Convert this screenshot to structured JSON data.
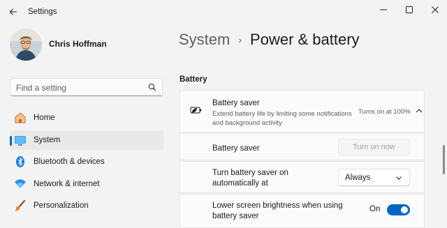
{
  "app": {
    "title": "Settings"
  },
  "user": {
    "name": "Chris Hoffman"
  },
  "search": {
    "placeholder": "Find a setting"
  },
  "nav": {
    "items": [
      {
        "label": "Home",
        "icon": "home-icon"
      },
      {
        "label": "System",
        "icon": "system-icon",
        "active": true
      },
      {
        "label": "Bluetooth & devices",
        "icon": "bluetooth-icon"
      },
      {
        "label": "Network & internet",
        "icon": "network-icon"
      },
      {
        "label": "Personalization",
        "icon": "brush-icon"
      }
    ]
  },
  "breadcrumb": {
    "parent": "System",
    "separator": "›",
    "current": "Power & battery"
  },
  "battery": {
    "section_title": "Battery",
    "saver": {
      "title": "Battery saver",
      "description": "Extend battery life by limiting some notifications and background activity",
      "status": "Turns on at 100%",
      "expanded": true
    },
    "saver_now": {
      "label": "Battery saver",
      "button_label": "Turn on now",
      "button_enabled": false
    },
    "auto_on": {
      "label": "Turn battery saver on automatically at",
      "selected": "Always"
    },
    "brightness": {
      "label": "Lower screen brightness when using battery saver",
      "state_label": "On",
      "on": true
    }
  },
  "colors": {
    "accent": "#0067c0",
    "background": "#f3f3f3",
    "card": "#fbfbfb"
  }
}
